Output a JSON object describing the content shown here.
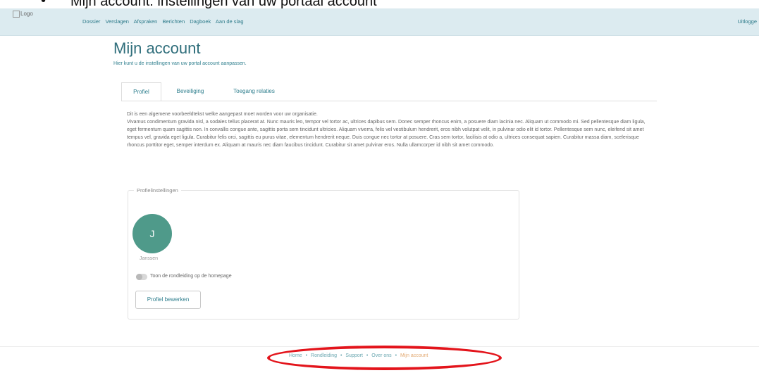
{
  "caption": {
    "bullet": "•",
    "text": "Mijn account: instellingen van uw portaal account"
  },
  "topbar": {
    "logo_alt": "Logo",
    "nav_items": [
      "Dossier",
      "Verslagen",
      "Afspraken",
      "Berichten",
      "Dagboek",
      "Aan de slag"
    ],
    "logout": "Uitlogge"
  },
  "page": {
    "title": "Mijn account",
    "subtitle": "Hier kunt u de instellingen van uw portal account aanpassen."
  },
  "tabs": [
    {
      "label": "Profiel",
      "active": true
    },
    {
      "label": "Beveiliging",
      "active": false
    },
    {
      "label": "Toegang relaties",
      "active": false
    }
  ],
  "intro": {
    "line1": "Dit is een algemene voorbeeldtekst welke aangepast moet worden voor uw organisatie.",
    "paragraph": "Vivamus condimentum gravida nisl, a sodales tellus placerat at. Nunc mauris leo, tempor vel tortor ac, ultrices dapibus sem. Donec semper rhoncus enim, a posuere diam lacinia nec. Aliquam ut commodo mi. Sed pellentesque diam ligula, eget fermentum quam sagittis non. In convallis congue ante, sagittis porta sem tincidunt ultricies. Aliquam viverra, felis vel vestibulum hendrerit, eros nibh volutpat velit, in pulvinar odio elit id tortor. Pellentesque sem nunc, eleifend sit amet tempus vel, gravida eget ligula. Curabitur felis orci, sagittis eu purus vitae, elementum hendrerit neque. Duis congue nec tortor at posuere. Cras sem tortor, facilisis at odio a, ultrices consequat sapien. Curabitur massa diam, scelerisque rhoncus porttitor eget, semper interdum ex. Aliquam at mauris nec diam faucibus tincidunt. Curabitur sit amet pulvinar eros. Nulla ullamcorper id nibh sit amet commodo."
  },
  "profile": {
    "legend": "Profielinstellingen",
    "avatar_initial": "J",
    "name": "Janssen",
    "toggle_label": "Toon de rondleiding op de homepage",
    "edit_button": "Profiel bewerken"
  },
  "footer": {
    "links": [
      "Home",
      "Rondleiding",
      "Support",
      "Over ons",
      "Mijn account"
    ],
    "separator": "•"
  },
  "colors": {
    "accent": "#2f7f8e",
    "avatar": "#4f9a8a",
    "footer_active": "#e2a870",
    "highlight": "#e3141b",
    "topbar_bg": "#dcebf0"
  }
}
